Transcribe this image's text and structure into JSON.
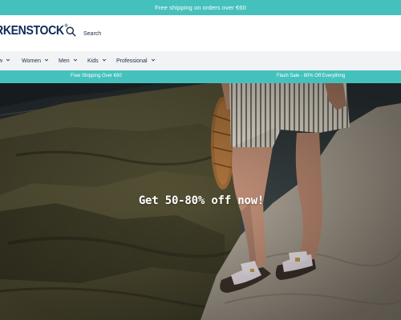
{
  "colors": {
    "teal": "#45c1bd",
    "navy": "#0f2a57",
    "nav_bg": "#f1f3f5"
  },
  "top_banner": {
    "text": "Free shipping on orders over €60"
  },
  "header": {
    "logo_text": "RKENSTOCK",
    "search_label": "Search",
    "search_icon": "search-icon"
  },
  "nav": {
    "items": [
      {
        "label": "w"
      },
      {
        "label": "Women"
      },
      {
        "label": "Men"
      },
      {
        "label": "Kids"
      },
      {
        "label": "Professional"
      }
    ]
  },
  "promo_strip": {
    "left_text": "Free Shipping Over €60",
    "right_text": "Flash Sale - 80% Off  Everything"
  },
  "hero": {
    "headline": "Get 50-80% off now!"
  }
}
